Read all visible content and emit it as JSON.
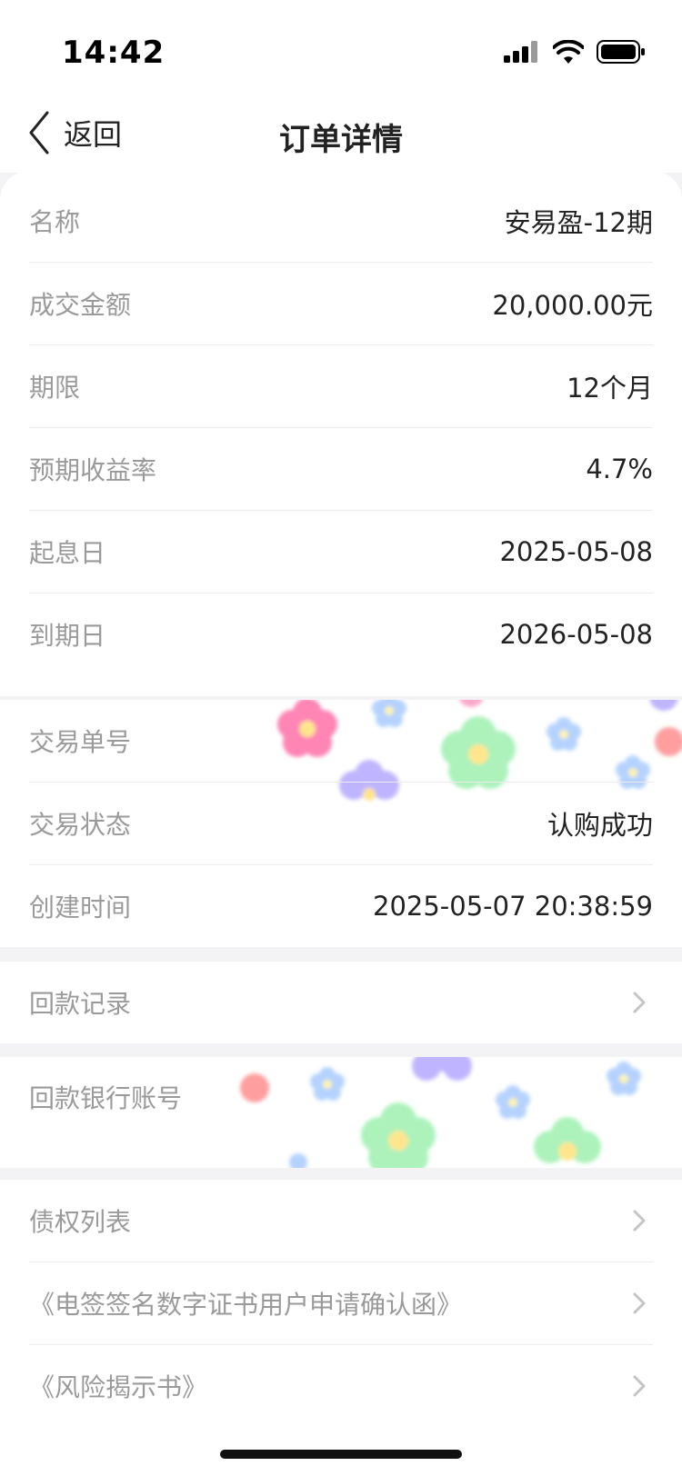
{
  "status_bar": {
    "time": "14:42",
    "icons": [
      "signal-icon",
      "wifi-icon",
      "battery-icon"
    ]
  },
  "nav": {
    "back_label": "返回",
    "title": "订单详情"
  },
  "product_info": [
    {
      "label": "名称",
      "value": "安易盈-12期"
    },
    {
      "label": "成交金额",
      "value": "20,000.00元"
    },
    {
      "label": "期限",
      "value": "12个月"
    },
    {
      "label": "预期收益率",
      "value": "4.7%"
    },
    {
      "label": "起息日",
      "value": "2025-05-08"
    },
    {
      "label": "到期日",
      "value": "2026-05-08"
    }
  ],
  "trade_info": [
    {
      "label": "交易单号",
      "value": ""
    },
    {
      "label": "交易状态",
      "value": "认购成功"
    },
    {
      "label": "创建时间",
      "value": "2025-05-07 20:38:59"
    }
  ],
  "repayment_record": {
    "label": "回款记录"
  },
  "bank_account": {
    "label": "回款银行账号"
  },
  "documents": [
    {
      "label": "债权列表"
    },
    {
      "label": "《电签签名数字证书用户申请确认函》"
    },
    {
      "label": "《风险揭示书》"
    }
  ],
  "colors": {
    "background": "#f3f3f5",
    "card": "#ffffff",
    "label": "#9a9a9a",
    "value": "#222222"
  }
}
